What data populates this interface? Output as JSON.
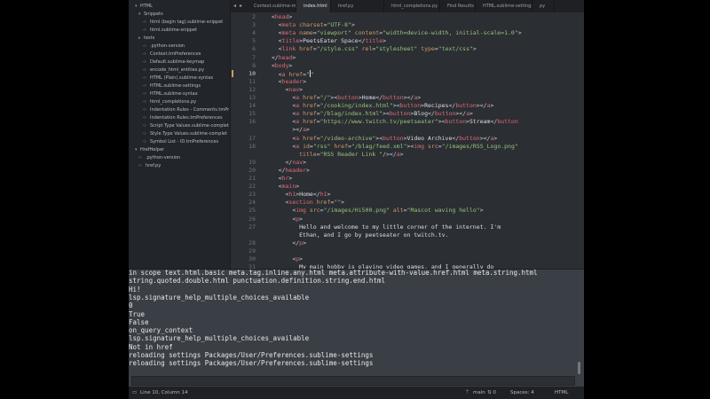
{
  "sidebar": {
    "items": [
      {
        "label": "HTML",
        "kind": "folder-open"
      },
      {
        "label": "Snippets",
        "kind": "folder-open"
      },
      {
        "label": "html (begin tag).sublime-snippet",
        "kind": "file"
      },
      {
        "label": "html.sublime-snippet",
        "kind": "file"
      },
      {
        "label": "tests",
        "kind": "folder"
      },
      {
        "label": ".python-version",
        "kind": "file"
      },
      {
        "label": "Context.tmPreferences",
        "kind": "file"
      },
      {
        "label": "Default.sublime-keymap",
        "kind": "file"
      },
      {
        "label": "encode_html_entities.py",
        "kind": "file"
      },
      {
        "label": "HTML (Plain).sublime-syntax",
        "kind": "file"
      },
      {
        "label": "HTML.sublime-settings",
        "kind": "file"
      },
      {
        "label": "HTML.sublime-syntax",
        "kind": "file"
      },
      {
        "label": "html_completions.py",
        "kind": "file"
      },
      {
        "label": "Indentation Rules - Comments.tmPr",
        "kind": "file"
      },
      {
        "label": "Indentation Rules.tmPreferences",
        "kind": "file"
      },
      {
        "label": "Script Type Values.sublime-complet",
        "kind": "file"
      },
      {
        "label": "Style Type Values.sublime-complet",
        "kind": "file"
      },
      {
        "label": "Symbol List - ID.tmPreferences",
        "kind": "file"
      },
      {
        "label": "HrefHelper",
        "kind": "folder-open"
      },
      {
        "label": ".python-version",
        "kind": "file"
      },
      {
        "label": "href.py",
        "kind": "file"
      }
    ]
  },
  "tabs": [
    {
      "label": "Context.sublime-menu",
      "active": false
    },
    {
      "label": "index.html",
      "active": true
    },
    {
      "label": "href.py",
      "active": false
    },
    {
      "label": "html_completions.py",
      "active": false
    },
    {
      "label": "Find Results",
      "active": false
    },
    {
      "label": "HTML.sublime-settings",
      "active": false
    },
    {
      "label": "py",
      "active": false
    }
  ],
  "editor": {
    "lines": [
      {
        "n": "2",
        "html": "  <span class='p'>&lt;</span><span class='t'>head</span><span class='p'>&gt;</span>"
      },
      {
        "n": "3",
        "html": "    <span class='p'>&lt;</span><span class='t'>meta</span> <span class='a'>charset</span><span class='p'>=</span><span class='s'>\"UTF-8\"</span><span class='p'>&gt;</span>"
      },
      {
        "n": "4",
        "html": "    <span class='p'>&lt;</span><span class='t'>meta</span> <span class='a'>name</span><span class='p'>=</span><span class='s'>\"viewport\"</span> <span class='a'>content</span><span class='p'>=</span><span class='s'>\"width=device-width, initial-scale=1.0\"</span><span class='p'>&gt;</span>"
      },
      {
        "n": "5",
        "html": "    <span class='p'>&lt;</span><span class='t'>title</span><span class='p'>&gt;</span><span class='x'>PeetsEater Space</span><span class='p'>&lt;/</span><span class='t'>title</span><span class='p'>&gt;</span>"
      },
      {
        "n": "6",
        "html": "    <span class='p'>&lt;</span><span class='t'>link</span> <span class='a'>href</span><span class='p'>=</span><span class='s'>\"/style.css\"</span> <span class='a'>rel</span><span class='p'>=</span><span class='s'>\"stylesheet\"</span> <span class='a'>type</span><span class='p'>=</span><span class='s'>\"text/css\"</span><span class='p'>&gt;</span>"
      },
      {
        "n": "7",
        "html": "  <span class='p'>&lt;/</span><span class='t'>head</span><span class='p'>&gt;</span>"
      },
      {
        "n": "8",
        "html": "  <span class='p'>&lt;</span><span class='t'>body</span><span class='p'>&gt;</span>"
      },
      {
        "n": "10",
        "html": "    <span class='p'>&lt;</span><span class='t'>a</span> <span class='a'>href</span><span class='p'>=</span><span class='s'>\"</span><span class='caret'></span><span class='s'>\"</span>",
        "current": true
      },
      {
        "n": "11",
        "html": "    <span class='p'>&lt;</span><span class='t'>header</span><span class='p'>&gt;</span>"
      },
      {
        "n": "12",
        "html": "      <span class='p'>&lt;</span><span class='t'>nav</span><span class='p'>&gt;</span>"
      },
      {
        "n": "13",
        "html": "        <span class='p'>&lt;</span><span class='t'>a</span> <span class='a'>href</span><span class='p'>=</span><span class='s'>\"/\"</span><span class='p'>&gt;&lt;</span><span class='t'>button</span><span class='p'>&gt;</span><span class='x'>Home</span><span class='p'>&lt;/</span><span class='t'>button</span><span class='p'>&gt;&lt;/</span><span class='t'>a</span><span class='p'>&gt;</span>"
      },
      {
        "n": "14",
        "html": "        <span class='p'>&lt;</span><span class='t'>a</span> <span class='a'>href</span><span class='p'>=</span><span class='s'>\"/cooking/index.html\"</span><span class='p'>&gt;&lt;</span><span class='t'>button</span><span class='p'>&gt;</span><span class='x'>Recipes</span><span class='p'>&lt;/</span><span class='t'>button</span><span class='p'>&gt;&lt;/</span><span class='t'>a</span><span class='p'>&gt;</span>"
      },
      {
        "n": "15",
        "html": "        <span class='p'>&lt;</span><span class='t'>a</span> <span class='a'>href</span><span class='p'>=</span><span class='s'>\"/blag/index.html\"</span><span class='p'>&gt;&lt;</span><span class='t'>button</span><span class='p'>&gt;</span><span class='x'>Blog</span><span class='p'>&lt;/</span><span class='t'>button</span><span class='p'>&gt;&lt;/</span><span class='t'>a</span><span class='p'>&gt;</span>"
      },
      {
        "n": "16",
        "html": "        <span class='p'>&lt;</span><span class='t'>a</span> <span class='a'>href</span><span class='p'>=</span><span class='s'>\"https://www.twitch.tv/peetseater\"</span><span class='p'>&gt;&lt;</span><span class='t'>button</span><span class='p'>&gt;</span><span class='x'>Stream</span><span class='p'>&lt;/</span><span class='t'>button</span>"
      },
      {
        "n": "",
        "html": "        <span class='p'>&gt;&lt;/</span><span class='t'>a</span><span class='p'>&gt;</span>"
      },
      {
        "n": "17",
        "html": "        <span class='p'>&lt;</span><span class='t'>a</span> <span class='a'>href</span><span class='p'>=</span><span class='s'>\"/video-archive\"</span><span class='p'>&gt;&lt;</span><span class='t'>button</span><span class='p'>&gt;</span><span class='x'>Video Archive</span><span class='p'>&lt;/</span><span class='t'>button</span><span class='p'>&gt;&lt;/</span><span class='t'>a</span><span class='p'>&gt;</span>"
      },
      {
        "n": "18",
        "html": "        <span class='p'>&lt;</span><span class='t'>a</span> <span class='a'>id</span><span class='p'>=</span><span class='s'>\"rss\"</span> <span class='a'>href</span><span class='p'>=</span><span class='s'>\"/blag/feed.xml\"</span><span class='p'>&gt;&lt;</span><span class='t'>img</span> <span class='a'>src</span><span class='p'>=</span><span class='s'>\"/images/RSS_Logo.png\"</span>"
      },
      {
        "n": "",
        "html": "          <span class='a'>title</span><span class='p'>=</span><span class='s'>\"RSS Reader Link \"</span><span class='p'>/&gt;&lt;/</span><span class='t'>a</span><span class='p'>&gt;</span>"
      },
      {
        "n": "19",
        "html": "      <span class='p'>&lt;/</span><span class='t'>nav</span><span class='p'>&gt;</span>"
      },
      {
        "n": "20",
        "html": "    <span class='p'>&lt;/</span><span class='t'>header</span><span class='p'>&gt;</span>"
      },
      {
        "n": "21",
        "html": "    <span class='p'>&lt;</span><span class='t'>hr</span><span class='p'>&gt;</span>"
      },
      {
        "n": "22",
        "html": "    <span class='p'>&lt;</span><span class='t'>main</span><span class='p'>&gt;</span>"
      },
      {
        "n": "23",
        "html": "      <span class='p'>&lt;</span><span class='t'>h1</span><span class='p'>&gt;</span><span class='x'>Home</span><span class='p'>&lt;/</span><span class='t'>h1</span><span class='p'>&gt;</span>"
      },
      {
        "n": "24",
        "html": "      <span class='p'>&lt;</span><span class='t'>section</span> <span class='a'>href</span><span class='p'>=</span><span class='s'>\"\"</span><span class='p'>&gt;</span>"
      },
      {
        "n": "25",
        "html": "        <span class='p'>&lt;</span><span class='t'>img</span> <span class='a'>src</span><span class='p'>=</span><span class='s'>\"/images/Hi500.png\"</span> <span class='a'>alt</span><span class='p'>=</span><span class='s'>\"Mascot waving hello\"</span><span class='p'>&gt;</span>"
      },
      {
        "n": "26",
        "html": "        <span class='p'>&lt;</span><span class='t'>p</span><span class='p'>&gt;</span>"
      },
      {
        "n": "27",
        "html": "          <span class='x'>Hello and welcome to my little corner of the internet. I'm</span>"
      },
      {
        "n": "",
        "html": "          <span class='x'>Ethan, and I go by peetseater on twitch.tv.</span>"
      },
      {
        "n": "28",
        "html": "        <span class='p'>&lt;/</span><span class='t'>p</span><span class='p'>&gt;</span>"
      },
      {
        "n": "29",
        "html": ""
      },
      {
        "n": "30",
        "html": "        <span class='p'>&lt;</span><span class='t'>p</span><span class='p'>&gt;</span>"
      },
      {
        "n": "31",
        "html": "          <span class='x'>My main hobby is playing video games, and I generally do</span>"
      }
    ]
  },
  "panel": {
    "lines": [
      "in scope text.html.basic meta.tag.inline.any.html meta.attribute-with-value.href.html meta.string.html",
      "string.quoted.double.html punctuation.definition.string.end.html",
      "Hi!",
      "lsp.signature_help_multiple_choices_available",
      "0",
      "True",
      "False",
      "on_query_context",
      "lsp.signature_help_multiple_choices_available",
      "Not in href",
      "reloading settings Packages/User/Preferences.sublime-settings",
      "reloading settings Packages/User/Preferences.sublime-settings"
    ]
  },
  "status": {
    "position": "Line 10, Column 14",
    "branch": "main",
    "branch_count": "0",
    "indent": "Spaces: 4",
    "syntax": "HTML"
  }
}
